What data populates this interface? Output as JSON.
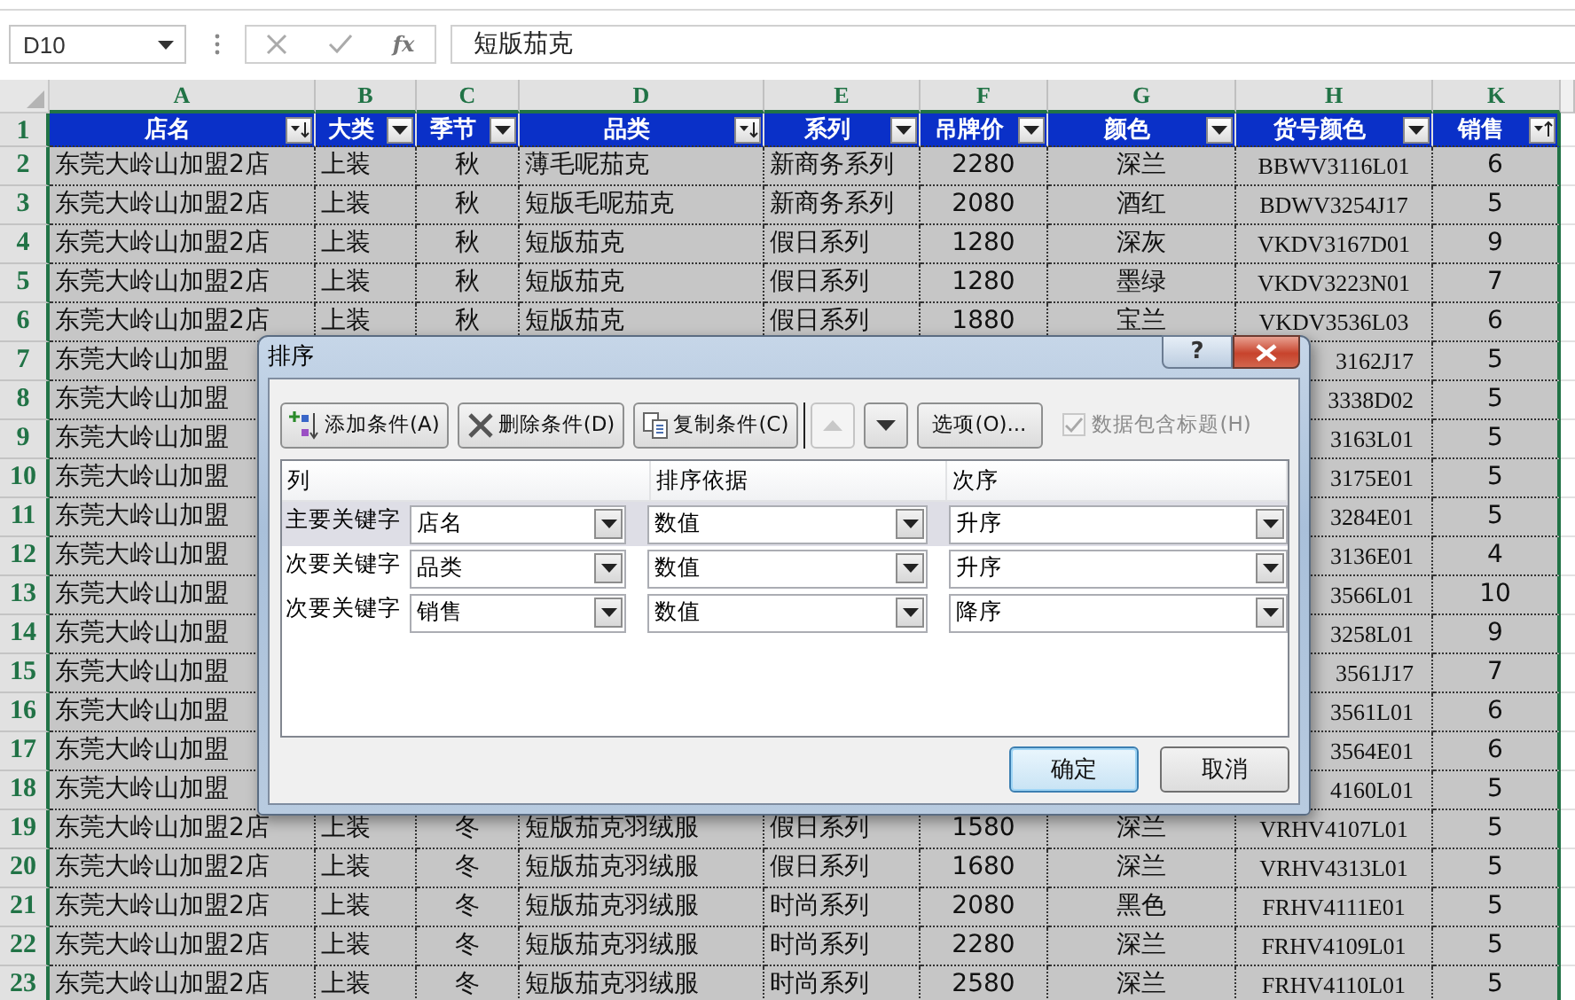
{
  "name_box": {
    "value": "D10"
  },
  "formula_bar": {
    "fx_label": "fx",
    "value": "短版茄克"
  },
  "column_headers": [
    "A",
    "B",
    "C",
    "D",
    "E",
    "F",
    "G",
    "H",
    "K"
  ],
  "header_row": {
    "number": "1",
    "cells": [
      {
        "label": "店名",
        "kind": "sorted_up"
      },
      {
        "label": "大类",
        "kind": "filter"
      },
      {
        "label": "季节",
        "kind": "filter"
      },
      {
        "label": "品类",
        "kind": "sorted_up"
      },
      {
        "label": "系列",
        "kind": "filter"
      },
      {
        "label": "吊牌价",
        "kind": "filter"
      },
      {
        "label": "颜色",
        "kind": "filter"
      },
      {
        "label": "货号颜色",
        "kind": "filter"
      },
      {
        "label": "销售",
        "kind": "sorted_down"
      }
    ]
  },
  "rows": [
    {
      "kind": "full",
      "number": "2",
      "cells": [
        "东莞大岭山加盟2店",
        "上装",
        "秋",
        "薄毛呢茄克",
        "新商务系列",
        "2280",
        "深兰",
        "BBWV3116L01",
        "6"
      ]
    },
    {
      "kind": "full",
      "number": "3",
      "cells": [
        "东莞大岭山加盟2店",
        "上装",
        "秋",
        "短版毛呢茄克",
        "新商务系列",
        "2080",
        "酒红",
        "BDWV3254J17",
        "5"
      ]
    },
    {
      "kind": "full",
      "number": "4",
      "cells": [
        "东莞大岭山加盟2店",
        "上装",
        "秋",
        "短版茄克",
        "假日系列",
        "1280",
        "深灰",
        "VKDV3167D01",
        "9"
      ]
    },
    {
      "kind": "full",
      "number": "5",
      "cells": [
        "东莞大岭山加盟2店",
        "上装",
        "秋",
        "短版茄克",
        "假日系列",
        "1280",
        "墨绿",
        "VKDV3223N01",
        "7"
      ]
    },
    {
      "kind": "full",
      "number": "6",
      "cells": [
        "东莞大岭山加盟2店",
        "上装",
        "秋",
        "短版茄克",
        "假日系列",
        "1880",
        "宝兰",
        "VKDV3536L03",
        "6"
      ]
    },
    {
      "kind": "partial",
      "number": "7",
      "first": "东莞大岭山加盟",
      "code_tail": "3162J17",
      "sales": "5"
    },
    {
      "kind": "partial",
      "number": "8",
      "first": "东莞大岭山加盟",
      "code_tail": "3338D02",
      "sales": "5"
    },
    {
      "kind": "partial",
      "number": "9",
      "first": "东莞大岭山加盟",
      "code_tail": "3163L01",
      "sales": "5"
    },
    {
      "kind": "partial",
      "number": "10",
      "first": "东莞大岭山加盟",
      "code_tail": "3175E01",
      "sales": "5"
    },
    {
      "kind": "partial",
      "number": "11",
      "first": "东莞大岭山加盟",
      "code_tail": "3284E01",
      "sales": "5"
    },
    {
      "kind": "partial",
      "number": "12",
      "first": "东莞大岭山加盟",
      "code_tail": "3136E01",
      "sales": "4"
    },
    {
      "kind": "partial",
      "number": "13",
      "first": "东莞大岭山加盟",
      "code_tail": "3566L01",
      "sales": "10"
    },
    {
      "kind": "partial",
      "number": "14",
      "first": "东莞大岭山加盟",
      "code_tail": "3258L01",
      "sales": "9"
    },
    {
      "kind": "partial",
      "number": "15",
      "first": "东莞大岭山加盟",
      "code_tail": "3561J17",
      "sales": "7"
    },
    {
      "kind": "partial",
      "number": "16",
      "first": "东莞大岭山加盟",
      "code_tail": "3561L01",
      "sales": "6"
    },
    {
      "kind": "partial",
      "number": "17",
      "first": "东莞大岭山加盟",
      "code_tail": "3564E01",
      "sales": "6"
    },
    {
      "kind": "partial",
      "number": "18",
      "first": "东莞大岭山加盟",
      "code_tail": "4160L01",
      "sales": "5"
    },
    {
      "kind": "full",
      "number": "19",
      "cells": [
        "东莞大岭山加盟2店",
        "上装",
        "冬",
        "短版茄克羽绒服",
        "假日系列",
        "1580",
        "深兰",
        "VRHV4107L01",
        "5"
      ]
    },
    {
      "kind": "full",
      "number": "20",
      "cells": [
        "东莞大岭山加盟2店",
        "上装",
        "冬",
        "短版茄克羽绒服",
        "假日系列",
        "1680",
        "深兰",
        "VRHV4313L01",
        "5"
      ]
    },
    {
      "kind": "full",
      "number": "21",
      "cells": [
        "东莞大岭山加盟2店",
        "上装",
        "冬",
        "短版茄克羽绒服",
        "时尚系列",
        "2080",
        "黑色",
        "FRHV4111E01",
        "5"
      ]
    },
    {
      "kind": "full",
      "number": "22",
      "cells": [
        "东莞大岭山加盟2店",
        "上装",
        "冬",
        "短版茄克羽绒服",
        "时尚系列",
        "2280",
        "深兰",
        "FRHV4109L01",
        "5"
      ]
    },
    {
      "kind": "full",
      "number": "23",
      "cells": [
        "东莞大岭山加盟2店",
        "上装",
        "冬",
        "短版茄克羽绒服",
        "时尚系列",
        "2580",
        "深兰",
        "FRHV4110L01",
        "5"
      ]
    }
  ],
  "dialog": {
    "title": "排序",
    "help_label": "?",
    "toolbar": [
      {
        "kind": "add",
        "label": "添加条件(A)"
      },
      {
        "kind": "delete",
        "label": "删除条件(D)"
      },
      {
        "kind": "copy",
        "label": "复制条件(C)"
      }
    ],
    "move_up": {
      "disabled": true
    },
    "move_down": {
      "disabled": false
    },
    "options_label": "选项(O)...",
    "header_checkbox": {
      "label": "数据包含标题(H)",
      "checked": true,
      "disabled": true
    },
    "columns": [
      "列",
      "排序依据",
      "次序"
    ],
    "levels": [
      {
        "label": "主要关键字",
        "column": "店名",
        "sort_on": "数值",
        "order": "升序",
        "selected": true
      },
      {
        "label": "次要关键字",
        "column": "品类",
        "sort_on": "数值",
        "order": "升序",
        "selected": false
      },
      {
        "label": "次要关键字",
        "column": "销售",
        "sort_on": "数值",
        "order": "降序",
        "selected": false
      }
    ],
    "buttons": [
      {
        "label": "确定",
        "default": true
      },
      {
        "label": "取消",
        "default": false
      }
    ]
  }
}
